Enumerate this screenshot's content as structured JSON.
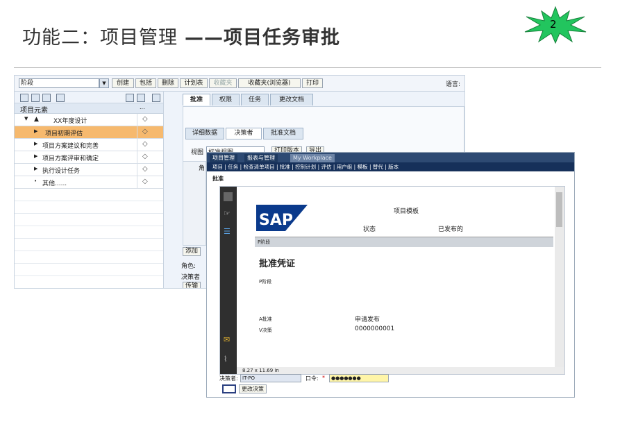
{
  "slide": {
    "title_main": "功能二：项目管理",
    "title_sub": "——项目任务审批",
    "page_number": "2"
  },
  "window1": {
    "stage_select": "阶段",
    "toolbar": [
      "创建",
      "包括",
      "删除",
      "计划表",
      "收藏夹",
      "收藏夹(浏览器)",
      "打印"
    ],
    "language_label": "语言:",
    "tree_header": "项目元素",
    "tree_header_col2": "...",
    "tree_items": [
      "XX年度设计",
      "项目初期评估",
      "项目方案建议和完善",
      "项目方案评审和确定",
      "执行设计任务",
      "其他......"
    ],
    "tabs": [
      "批准",
      "权限",
      "任务",
      "更改文档"
    ],
    "subtabs": [
      "详细数据",
      "决策者",
      "批准文档"
    ],
    "view_label": "视图",
    "view_value": "标准视图",
    "print_btn": "打印版本",
    "export_btn": "导出",
    "add_btn": "添加",
    "role_label": "角色:",
    "decider_label": "决策者",
    "transfer_btn": "传输",
    "col_head": "角"
  },
  "window2": {
    "tabs": [
      "项目管理",
      "报表与管理",
      "My Workplace"
    ],
    "nav": "项目 | 任务 | 检查清单项目 | 批准 | 控制计划 | 评估 | 用户组 | 模板 | 替代 | 版本",
    "section_title": "批准",
    "doc": {
      "heading": "项目模板",
      "status_label": "状态",
      "status_value": "已发布的",
      "bar_label": "P阶段",
      "certificate": "批准凭证",
      "phase_label": "P阶段",
      "a_label": "A批准",
      "v_label": "V决策",
      "a_value": "申请发布",
      "v_value": "0000000001"
    },
    "page_size": "8.27 x 11.69 in",
    "footer": {
      "decider_label": "决策者:",
      "decider_value": "IT-PO",
      "password_label": "口令:",
      "password_star": "*",
      "password_value": "●●●●●●●",
      "change_btn": "更改决策"
    }
  },
  "colors": {
    "sap_blue": "#0a3a8c",
    "highlight_orange": "#f6b96e",
    "star_green": "#22c55e"
  }
}
